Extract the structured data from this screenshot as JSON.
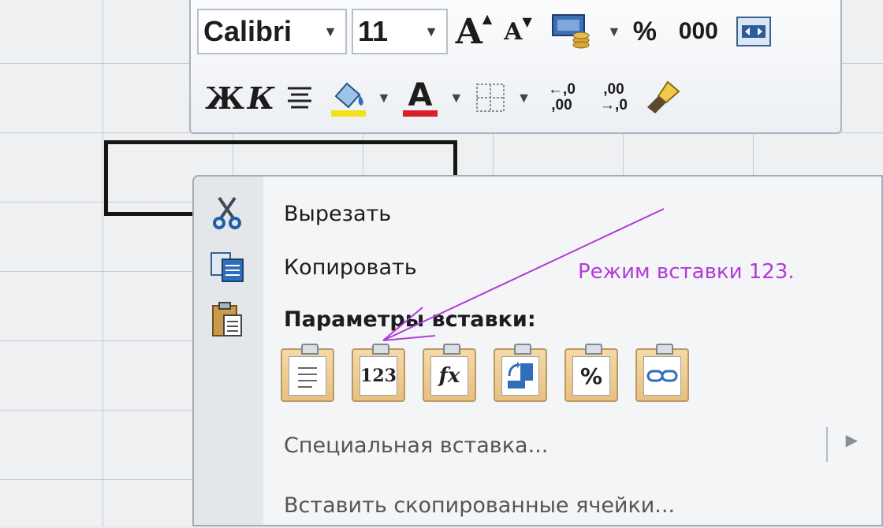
{
  "mini_toolbar": {
    "font_name": "Calibri",
    "font_size": "11",
    "percent_label": "%",
    "thousands_label": "000",
    "bold_label": "Ж",
    "italic_label": "К",
    "highlight_color": "#f3e21a",
    "font_color": "#d8202a",
    "increase_decimal_top": "←,0",
    "increase_decimal_bottom": ",00",
    "decrease_decimal_top": ",00",
    "decrease_decimal_bottom": "→,0"
  },
  "context_menu": {
    "cut": "Вырезать",
    "copy": "Копировать",
    "paste_options": "Параметры вставки:",
    "paste_special": "Специальная вставка...",
    "insert_copied_cells": "Вставить скопированные ячейки...",
    "paste_buttons": [
      {
        "name": "paste-button",
        "icon": "paste-page-icon",
        "label": ""
      },
      {
        "name": "paste-values-button",
        "icon": "values-icon",
        "label": "123"
      },
      {
        "name": "paste-formulas-button",
        "icon": "formula-icon",
        "label": "fx"
      },
      {
        "name": "paste-transpose-button",
        "icon": "transpose-icon",
        "label": ""
      },
      {
        "name": "paste-formatting-button",
        "icon": "percent-brush-icon",
        "label": "%"
      },
      {
        "name": "paste-link-button",
        "icon": "link-icon",
        "label": ""
      }
    ]
  },
  "annotation": {
    "text": "Режим вставки 123.",
    "color": "#b23ad8"
  }
}
